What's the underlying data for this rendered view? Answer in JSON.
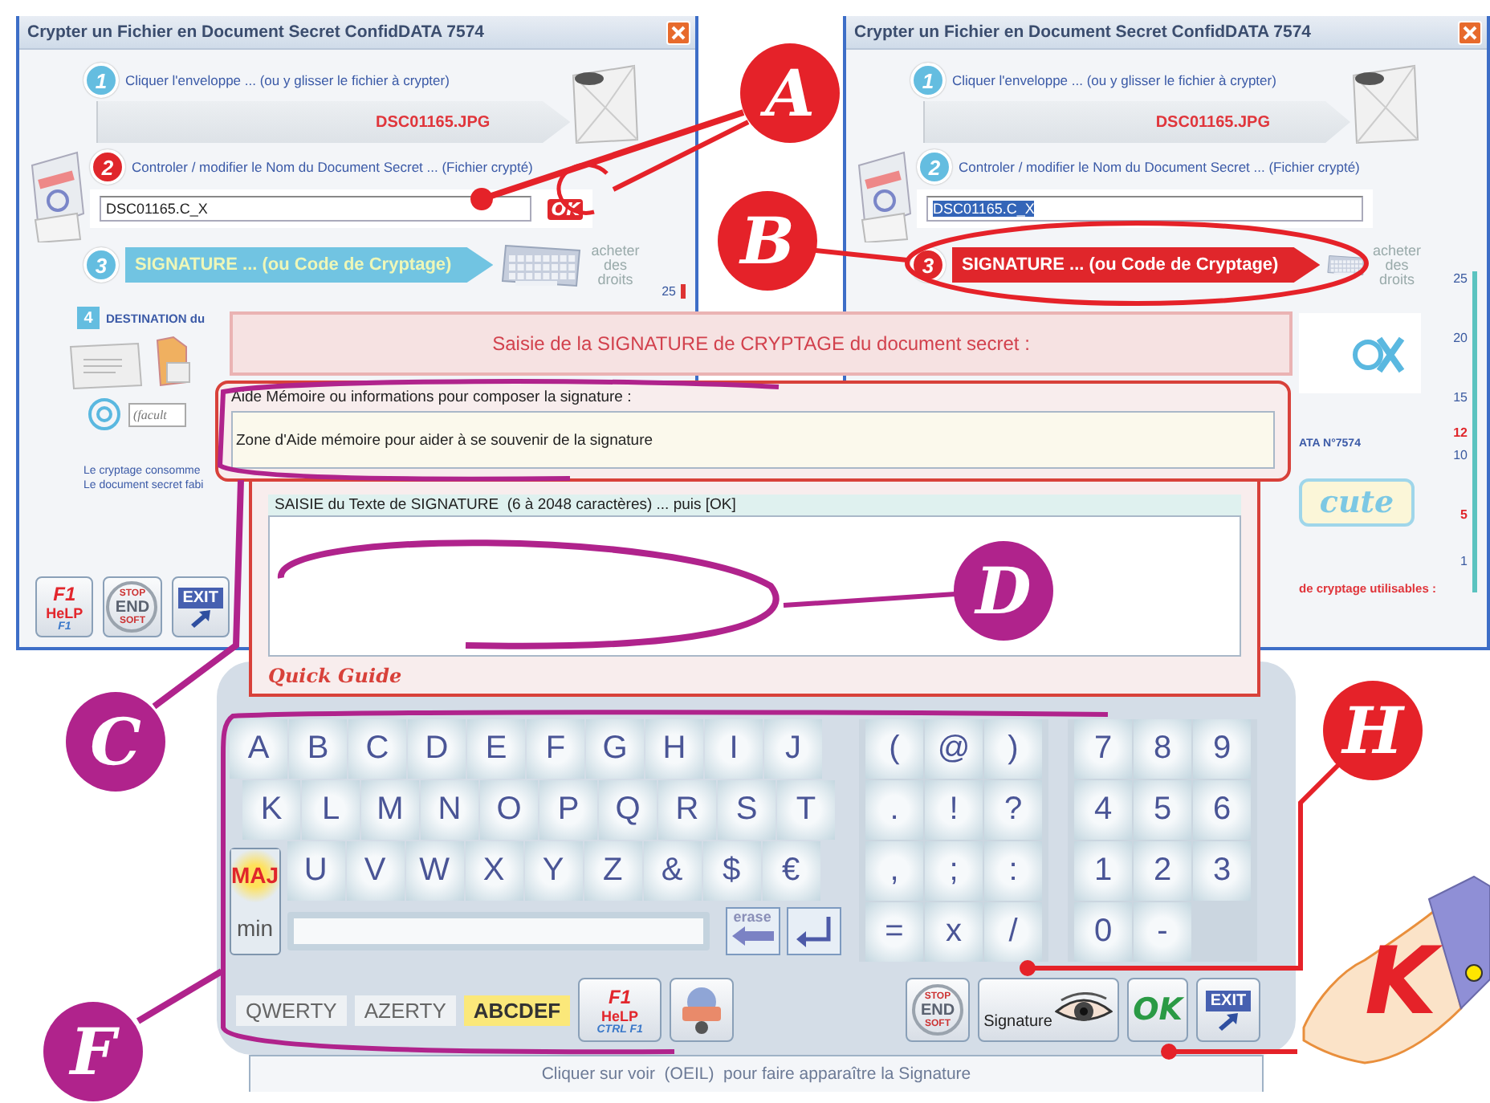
{
  "windows": [
    {
      "title": "Crypter un Fichier en Document Secret ConfidDATA 7574",
      "step1": {
        "number": "1",
        "label": "Cliquer l'enveloppe ... (ou y glisser le fichier à crypter)",
        "active": false
      },
      "source_file": "DSC01165.JPG",
      "step2": {
        "number": "2",
        "label": "Controler / modifier le Nom du Document Secret ... (Fichier crypté)",
        "active": true
      },
      "document_name": {
        "value": "DSC01165.C_X",
        "selected": false
      },
      "ok_button": "OK",
      "step3": {
        "number": "3",
        "label": "SIGNATURE ... (ou Code de Cryptage)",
        "active": false
      },
      "buy_rights": "acheter des droits",
      "gauge": [
        {
          "label": "25",
          "highlight": false
        }
      ],
      "step4": {
        "number": "4",
        "label": "DESTINATION du",
        "active": false
      },
      "destination_field": "(facult",
      "notes": [
        "Le cryptage consomme",
        "Le document secret fabi"
      ],
      "buttons": [
        {
          "kind": "help",
          "lines": [
            "F1",
            "HeLP",
            "F1"
          ]
        },
        {
          "kind": "stop",
          "lines": [
            "STOP",
            "END",
            "SOFT"
          ]
        },
        {
          "kind": "exit",
          "lines": [
            "EXIT"
          ]
        }
      ]
    },
    {
      "title": "Crypter un Fichier en Document Secret ConfidDATA 7574",
      "step1": {
        "number": "1",
        "label": "Cliquer l'enveloppe ... (ou y glisser le fichier à crypter)",
        "active": false
      },
      "source_file": "DSC01165.JPG",
      "step2": {
        "number": "2",
        "label": "Controler / modifier le Nom du Document Secret ... (Fichier crypté)",
        "active": false
      },
      "document_name": {
        "value": "DSC01165.C_X",
        "selected": true
      },
      "step3": {
        "number": "3",
        "label": "SIGNATURE ... (ou Code de Cryptage)",
        "active": true
      },
      "buy_rights": "acheter des droits",
      "gauge": [
        {
          "label": "25",
          "highlight": false
        },
        {
          "label": "20",
          "highlight": false
        },
        {
          "label": "15",
          "highlight": false
        },
        {
          "label": "12",
          "highlight": true
        },
        {
          "label": "10",
          "highlight": false
        },
        {
          "label": "5",
          "highlight": true
        },
        {
          "label": "1",
          "highlight": false
        }
      ],
      "licence_note": "ATA N°7574",
      "execute_button": "cute",
      "usable_note": "de cryptage utilisables :"
    }
  ],
  "dialog": {
    "title": "Saisie de la SIGNATURE de CRYPTAGE du document secret :",
    "memo": {
      "label": "Aide Mémoire ou informations pour composer la signature :",
      "value": "Zone d'Aide mémoire pour aider à se souvenir de la signature"
    },
    "signature_label": "SAISIE du Texte de SIGNATURE  (6 à 2048 caractères) ... puis [OK]",
    "quick_guide": "Quick Guide"
  },
  "keyboard": {
    "letter_rows": [
      [
        "A",
        "B",
        "C",
        "D",
        "E",
        "F",
        "G",
        "H",
        "I",
        "J"
      ],
      [
        "K",
        "L",
        "M",
        "N",
        "O",
        "P",
        "Q",
        "R",
        "S",
        "T"
      ],
      [
        "U",
        "V",
        "W",
        "X",
        "Y",
        "Z",
        "&",
        "$",
        "€"
      ]
    ],
    "symbol_rows": [
      [
        "(",
        "@",
        ")"
      ],
      [
        ".",
        "!",
        "?"
      ],
      [
        ",",
        ";",
        ":"
      ],
      [
        "=",
        "x",
        "/"
      ]
    ],
    "number_rows": [
      [
        "7",
        "8",
        "9"
      ],
      [
        "4",
        "5",
        "6"
      ],
      [
        "1",
        "2",
        "3"
      ],
      [
        "0",
        "-"
      ]
    ],
    "case_toggle": [
      {
        "label": "MAJ",
        "selected": true
      },
      {
        "label": "min",
        "selected": false
      }
    ],
    "erase_label": "erase",
    "layouts": [
      {
        "label": "QWERTY",
        "selected": false
      },
      {
        "label": "AZERTY",
        "selected": false
      },
      {
        "label": "ABCDEF",
        "selected": true
      }
    ],
    "buttons": [
      {
        "kind": "help",
        "lines": [
          "F1",
          "HeLP",
          "CTRL F1"
        ]
      },
      {
        "kind": "confidata"
      },
      {
        "kind": "stop",
        "lines": [
          "STOP",
          "END",
          "SOFT"
        ]
      },
      {
        "kind": "signature",
        "lines": [
          "Signature"
        ]
      },
      {
        "kind": "ok",
        "lines": [
          "OK"
        ]
      },
      {
        "kind": "exit",
        "lines": [
          "EXIT"
        ]
      }
    ],
    "status": "Cliquer sur voir  (OEIL)  pour faire apparaître la Signature"
  },
  "callouts": [
    {
      "letter": "A",
      "color": "#e52229",
      "kind": "circle"
    },
    {
      "letter": "B",
      "color": "#e52229",
      "kind": "circle"
    },
    {
      "letter": "C",
      "color": "#b0238c",
      "kind": "circle"
    },
    {
      "letter": "D",
      "color": "#b0238c",
      "kind": "circle"
    },
    {
      "letter": "F",
      "color": "#b0238c",
      "kind": "circle"
    },
    {
      "letter": "H",
      "color": "#e52229",
      "kind": "circle"
    },
    {
      "letter": "K",
      "color": "#e52229",
      "kind": "plain"
    }
  ]
}
